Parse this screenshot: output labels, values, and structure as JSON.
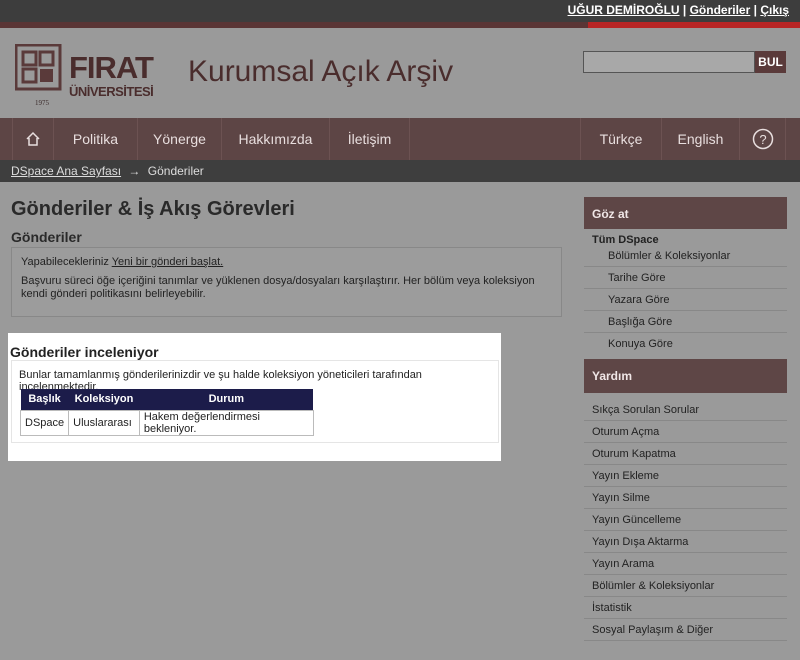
{
  "user": {
    "name": "UĞUR DEMİROĞLU",
    "separator": " | ",
    "submissions_link": "Gönderiler",
    "logout_link": "Çıkış"
  },
  "header": {
    "logo_name": "FIRAT",
    "logo_sub": "ÜNİVERSİTESİ",
    "logo_year": "1975",
    "title": "Kurumsal Açık Arşiv",
    "search_placeholder": "",
    "search_button": "BUL"
  },
  "nav": {
    "items": [
      "Politika",
      "Yönerge",
      "Hakkımızda",
      "İletişim"
    ],
    "lang_tr": "Türkçe",
    "lang_en": "English",
    "help": "?"
  },
  "breadcrumb": {
    "home": "DSpace Ana Sayfası",
    "arrow": "→",
    "current": "Gönderiler"
  },
  "main": {
    "page_title": "Gönderiler & İş Akış Görevleri",
    "submissions_title": "Gönderiler",
    "options_prefix": "Yapabilecekleriniz ",
    "new_submission_link": "Yeni bir gönderi başlat.",
    "description": "Başvuru süreci öğe içeriğini tanımlar ve yüklenen dosya/dosyaları karşılaştırır. Her bölüm veya koleksiyon kendi gönderi politikasını belirleyebilir.",
    "review": {
      "title": "Gönderiler inceleniyor",
      "desc": "Bunlar tamamlanmış gönderilerinizdir ve şu halde koleksiyon yöneticileri tarafından incelenmektedir.",
      "headers": [
        "Başlık",
        "Koleksiyon",
        "Durum"
      ],
      "rows": [
        [
          "DSpace",
          "Uluslararası",
          "Hakem değerlendirmesi bekleniyor."
        ]
      ]
    }
  },
  "sidebar": {
    "browse_title": "Göz at",
    "all_dspace": "Tüm DSpace",
    "browse_items": [
      "Bölümler & Koleksiyonlar",
      "Tarihe Göre",
      "Yazara Göre",
      "Başlığa Göre",
      "Konuya Göre"
    ],
    "help_title": "Yardım",
    "help_items": [
      "Sıkça Sorulan Sorular",
      "Oturum Açma",
      "Oturum Kapatma",
      "Yayın Ekleme",
      "Yayın Silme",
      "Yayın Güncelleme",
      "Yayın Dışa Aktarma",
      "Yayın Arama",
      "Bölümler & Koleksiyonlar",
      "İstatistik",
      "Sosyal Paylaşım & Diğer"
    ]
  },
  "colors": {
    "brand": "#5e4646",
    "table_header": "#1c1c4a",
    "accent_red": "#b72525"
  }
}
